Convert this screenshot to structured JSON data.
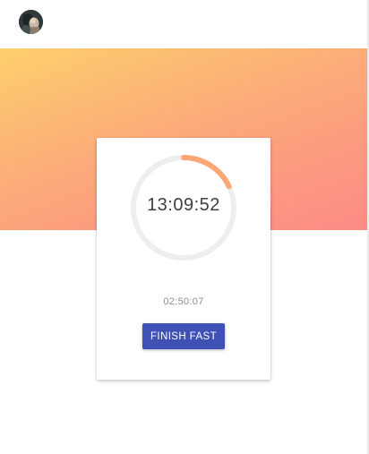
{
  "header": {
    "avatar_icon": "user-avatar-photo"
  },
  "hero": {
    "gradient_start": "#fdd06c",
    "gradient_end": "#fc8a86"
  },
  "timer": {
    "time_remaining": "13:09:52",
    "elapsed": "02:50:07",
    "progress_fraction": 0.18,
    "track_color": "#eeeeee",
    "progress_color": "#fca774"
  },
  "actions": {
    "finish_label": "FINISH FAST",
    "button_color": "#3f51b5"
  }
}
